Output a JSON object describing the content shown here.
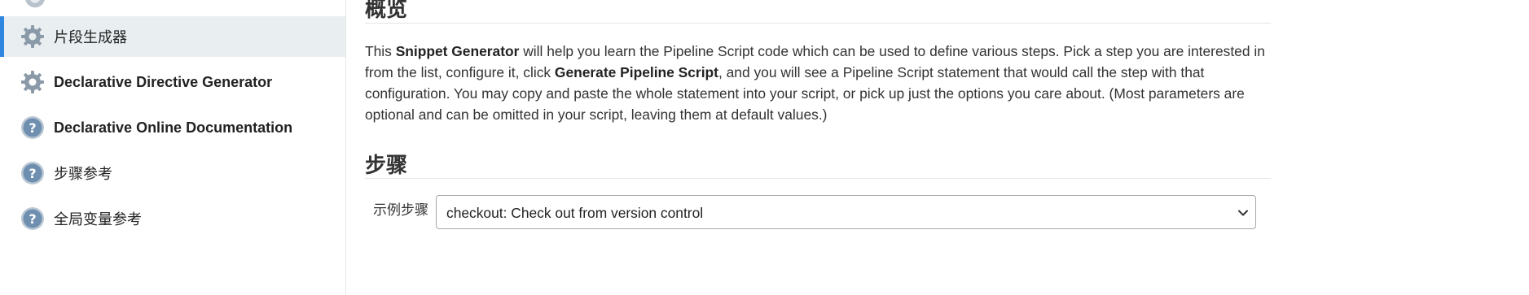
{
  "sidebar": {
    "items": [
      {
        "label": "片段生成器",
        "icon": "gear-icon",
        "active": true,
        "bold": false
      },
      {
        "label": "Declarative Directive Generator",
        "icon": "gear-icon",
        "active": false,
        "bold": true
      },
      {
        "label": "Declarative Online Documentation",
        "icon": "help-icon",
        "active": false,
        "bold": true
      },
      {
        "label": "步骤参考",
        "icon": "help-icon",
        "active": false,
        "bold": false
      },
      {
        "label": "全局变量参考",
        "icon": "help-icon",
        "active": false,
        "bold": false
      }
    ]
  },
  "overview": {
    "heading": "概览",
    "text_part1": "This ",
    "snippet_generator": "Snippet Generator",
    "text_part2": " will help you learn the Pipeline Script code which can be used to define various steps. Pick a step you are interested in from the list, configure it, click ",
    "generate_pipeline_script": "Generate Pipeline Script",
    "text_part3": ", and you will see a Pipeline Script statement that would call the step with that configuration. You may copy and paste the whole statement into your script, or pick up just the options you care about. (Most parameters are optional and can be omitted in your script, leaving them at default values.)"
  },
  "steps": {
    "heading": "步骤",
    "field_label": "示例步骤",
    "selected_value": "checkout: Check out from version control"
  },
  "colors": {
    "active_accent": "#2f87e0",
    "active_background": "#e9eff1",
    "icon_gray": "#8a9aa8",
    "help_icon_blue": "#6f8fb0"
  }
}
